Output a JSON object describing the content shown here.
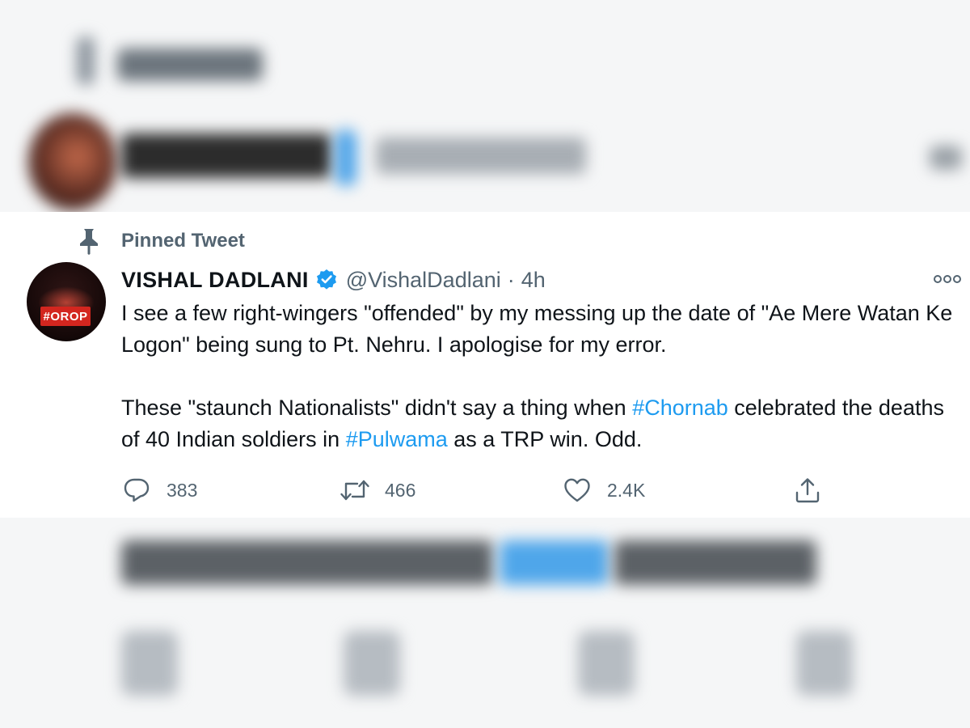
{
  "tweet": {
    "pinned_label": "Pinned Tweet",
    "author_name": "VISHAL DADLANI",
    "handle": "@VishalDadlani",
    "separator": "·",
    "time": "4h",
    "avatar_text": "#OROP",
    "paragraph1": "I see a few right-wingers \"offended\" by my messing up the date of \"Ae Mere Watan Ke Logon\" being sung to Pt. Nehru. I apologise for my error.",
    "paragraph2": {
      "part1": "These \"staunch Nationalists\" didn't say a thing when ",
      "hashtag1": "#Chornab",
      "part2": " celebrated the deaths of 40 Indian soldiers in ",
      "hashtag2": "#Pulwama",
      "part3": " as a TRP win. Odd."
    },
    "actions": {
      "replies": "383",
      "retweets": "466",
      "likes": "2.4K"
    }
  },
  "colors": {
    "hashtag": "#1d9bf0",
    "secondary_text": "#536471",
    "verified_badge": "#1d9bf0"
  },
  "icons": [
    "pin-icon",
    "verified-badge-icon",
    "more-options-icon",
    "reply-icon",
    "retweet-icon",
    "like-icon",
    "share-icon"
  ]
}
